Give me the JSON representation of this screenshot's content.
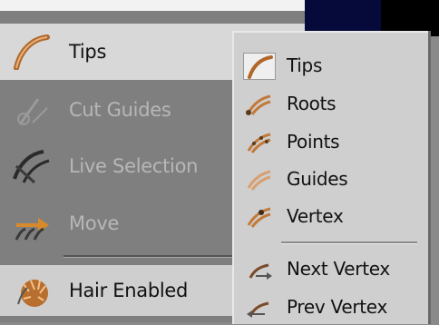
{
  "main_menu": {
    "items": [
      {
        "label": "Tips",
        "icon": "hair-tips-icon",
        "enabled": true
      },
      {
        "label": "Cut Guides",
        "icon": "scissors-icon",
        "enabled": false
      },
      {
        "label": "Live Selection",
        "icon": "live-selection-icon",
        "enabled": false
      },
      {
        "label": "Move",
        "icon": "move-arrow-icon",
        "enabled": false
      },
      {
        "label": "Hair Enabled",
        "icon": "hair-enabled-icon",
        "enabled": true
      }
    ]
  },
  "submenu": {
    "items": [
      {
        "label": "Tips",
        "icon": "tips-icon"
      },
      {
        "label": "Roots",
        "icon": "roots-icon"
      },
      {
        "label": "Points",
        "icon": "points-icon"
      },
      {
        "label": "Guides",
        "icon": "guides-icon"
      },
      {
        "label": "Vertex",
        "icon": "vertex-icon"
      },
      {
        "label": "Next Vertex",
        "icon": "next-vertex-icon"
      },
      {
        "label": "Prev Vertex",
        "icon": "prev-vertex-icon"
      }
    ]
  },
  "colors": {
    "icon_orange": "#c27a3a",
    "disabled_text": "#b7b7b7",
    "menu_bg": "#7f7f7f",
    "submenu_bg": "#cfcfcf"
  }
}
